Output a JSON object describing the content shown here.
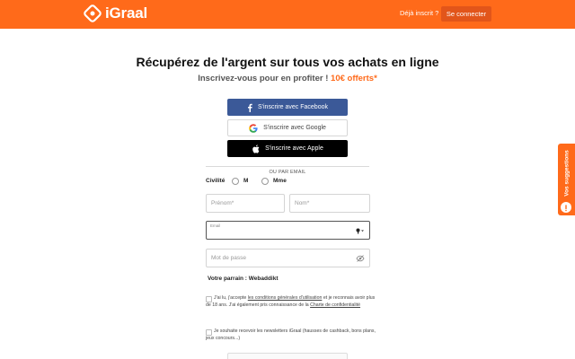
{
  "brand": {
    "name": "iGraal",
    "color": "#ff6a1a"
  },
  "header": {
    "already_member": "Déjà inscrit ?",
    "login_button": "Se connecter"
  },
  "hero": {
    "title": "Récupérez de l'argent sur tous vos achats en ligne",
    "subtitle": "Inscrivez-vous pour en profiter !",
    "offer": "10€ offerts*"
  },
  "social": {
    "facebook": "S'inscrire avec Facebook",
    "google": "S'inscrire avec Google",
    "apple": "S'inscrire avec Apple"
  },
  "separator": "OU PAR EMAIL",
  "form": {
    "civility_label": "Civilité",
    "civility_options": [
      "M",
      "Mme"
    ],
    "firstname_placeholder": "Prénom*",
    "lastname_placeholder": "Nom*",
    "email_label": "Email",
    "password_placeholder": "Mot de passe",
    "sponsor": "Votre parrain : Webaddikt"
  },
  "consent": {
    "terms_part1": "J'ai lu, j'accepte",
    "terms_link1": "les conditions générales d'utilisation",
    "terms_part2": "et je reconnais avoir plus de 18 ans. J'ai également pris connaissance de la",
    "terms_link2": "Charte de confidentialité",
    "newsletter": "Je souhaite recevoir les newsletters iGraal (hausses de cashback, bons plans, jeux concours...)"
  },
  "suggestions_tab": "Vos suggestions",
  "icons": [
    "igraal-logo-icon",
    "facebook-icon",
    "google-icon",
    "apple-icon",
    "key-icon",
    "eye-slash-icon",
    "suggestion-icon"
  ]
}
